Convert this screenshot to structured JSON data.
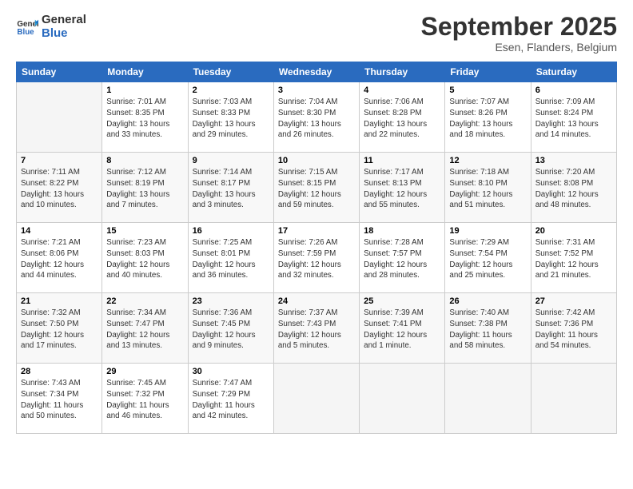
{
  "header": {
    "logo_line1": "General",
    "logo_line2": "Blue",
    "month": "September 2025",
    "location": "Esen, Flanders, Belgium"
  },
  "weekdays": [
    "Sunday",
    "Monday",
    "Tuesday",
    "Wednesday",
    "Thursday",
    "Friday",
    "Saturday"
  ],
  "weeks": [
    [
      {
        "day": "",
        "info": ""
      },
      {
        "day": "1",
        "info": "Sunrise: 7:01 AM\nSunset: 8:35 PM\nDaylight: 13 hours\nand 33 minutes."
      },
      {
        "day": "2",
        "info": "Sunrise: 7:03 AM\nSunset: 8:33 PM\nDaylight: 13 hours\nand 29 minutes."
      },
      {
        "day": "3",
        "info": "Sunrise: 7:04 AM\nSunset: 8:30 PM\nDaylight: 13 hours\nand 26 minutes."
      },
      {
        "day": "4",
        "info": "Sunrise: 7:06 AM\nSunset: 8:28 PM\nDaylight: 13 hours\nand 22 minutes."
      },
      {
        "day": "5",
        "info": "Sunrise: 7:07 AM\nSunset: 8:26 PM\nDaylight: 13 hours\nand 18 minutes."
      },
      {
        "day": "6",
        "info": "Sunrise: 7:09 AM\nSunset: 8:24 PM\nDaylight: 13 hours\nand 14 minutes."
      }
    ],
    [
      {
        "day": "7",
        "info": "Sunrise: 7:11 AM\nSunset: 8:22 PM\nDaylight: 13 hours\nand 10 minutes."
      },
      {
        "day": "8",
        "info": "Sunrise: 7:12 AM\nSunset: 8:19 PM\nDaylight: 13 hours\nand 7 minutes."
      },
      {
        "day": "9",
        "info": "Sunrise: 7:14 AM\nSunset: 8:17 PM\nDaylight: 13 hours\nand 3 minutes."
      },
      {
        "day": "10",
        "info": "Sunrise: 7:15 AM\nSunset: 8:15 PM\nDaylight: 12 hours\nand 59 minutes."
      },
      {
        "day": "11",
        "info": "Sunrise: 7:17 AM\nSunset: 8:13 PM\nDaylight: 12 hours\nand 55 minutes."
      },
      {
        "day": "12",
        "info": "Sunrise: 7:18 AM\nSunset: 8:10 PM\nDaylight: 12 hours\nand 51 minutes."
      },
      {
        "day": "13",
        "info": "Sunrise: 7:20 AM\nSunset: 8:08 PM\nDaylight: 12 hours\nand 48 minutes."
      }
    ],
    [
      {
        "day": "14",
        "info": "Sunrise: 7:21 AM\nSunset: 8:06 PM\nDaylight: 12 hours\nand 44 minutes."
      },
      {
        "day": "15",
        "info": "Sunrise: 7:23 AM\nSunset: 8:03 PM\nDaylight: 12 hours\nand 40 minutes."
      },
      {
        "day": "16",
        "info": "Sunrise: 7:25 AM\nSunset: 8:01 PM\nDaylight: 12 hours\nand 36 minutes."
      },
      {
        "day": "17",
        "info": "Sunrise: 7:26 AM\nSunset: 7:59 PM\nDaylight: 12 hours\nand 32 minutes."
      },
      {
        "day": "18",
        "info": "Sunrise: 7:28 AM\nSunset: 7:57 PM\nDaylight: 12 hours\nand 28 minutes."
      },
      {
        "day": "19",
        "info": "Sunrise: 7:29 AM\nSunset: 7:54 PM\nDaylight: 12 hours\nand 25 minutes."
      },
      {
        "day": "20",
        "info": "Sunrise: 7:31 AM\nSunset: 7:52 PM\nDaylight: 12 hours\nand 21 minutes."
      }
    ],
    [
      {
        "day": "21",
        "info": "Sunrise: 7:32 AM\nSunset: 7:50 PM\nDaylight: 12 hours\nand 17 minutes."
      },
      {
        "day": "22",
        "info": "Sunrise: 7:34 AM\nSunset: 7:47 PM\nDaylight: 12 hours\nand 13 minutes."
      },
      {
        "day": "23",
        "info": "Sunrise: 7:36 AM\nSunset: 7:45 PM\nDaylight: 12 hours\nand 9 minutes."
      },
      {
        "day": "24",
        "info": "Sunrise: 7:37 AM\nSunset: 7:43 PM\nDaylight: 12 hours\nand 5 minutes."
      },
      {
        "day": "25",
        "info": "Sunrise: 7:39 AM\nSunset: 7:41 PM\nDaylight: 12 hours\nand 1 minute."
      },
      {
        "day": "26",
        "info": "Sunrise: 7:40 AM\nSunset: 7:38 PM\nDaylight: 11 hours\nand 58 minutes."
      },
      {
        "day": "27",
        "info": "Sunrise: 7:42 AM\nSunset: 7:36 PM\nDaylight: 11 hours\nand 54 minutes."
      }
    ],
    [
      {
        "day": "28",
        "info": "Sunrise: 7:43 AM\nSunset: 7:34 PM\nDaylight: 11 hours\nand 50 minutes."
      },
      {
        "day": "29",
        "info": "Sunrise: 7:45 AM\nSunset: 7:32 PM\nDaylight: 11 hours\nand 46 minutes."
      },
      {
        "day": "30",
        "info": "Sunrise: 7:47 AM\nSunset: 7:29 PM\nDaylight: 11 hours\nand 42 minutes."
      },
      {
        "day": "",
        "info": ""
      },
      {
        "day": "",
        "info": ""
      },
      {
        "day": "",
        "info": ""
      },
      {
        "day": "",
        "info": ""
      }
    ]
  ]
}
